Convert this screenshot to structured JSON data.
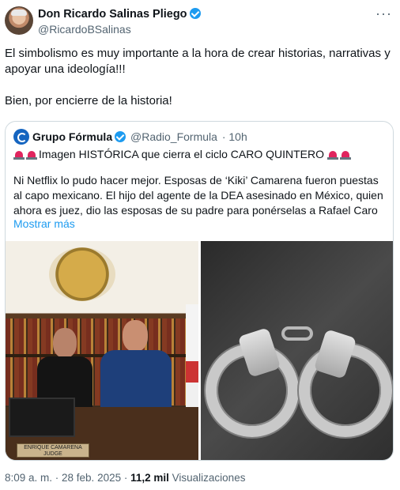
{
  "author": {
    "name": "Don Ricardo Salinas Pliego",
    "handle": "@RicardoBSalinas",
    "avatar_icon": "user-avatar",
    "verified_icon": "verified-badge-icon"
  },
  "menu_icon": "more-options-icon",
  "tweet": {
    "paragraph1": "El simbolismo es muy importante a la hora de crear historias, narrativas y apoyar una ideología!!!",
    "paragraph2": "Bien, por encierre de la historia!"
  },
  "quote": {
    "name": "Grupo Fórmula",
    "handle": "@Radio_Formula",
    "time": "· 10h",
    "headline": "Imagen HISTÓRICA que cierra el ciclo CARO QUINTERO",
    "body": "Ni Netflix lo pudo hacer mejor. Esposas de ‘Kiki’ Camarena fueron puestas al capo mexicano. El hijo del agente de la DEA asesinado en México, quien ahora es juez, dio las esposas de su padre para ponérselas a Rafael Caro",
    "more_label": "Mostrar más",
    "plate_line1": "ENRIQUE CAMARENA",
    "plate_line2": "JUDGE"
  },
  "footer": {
    "time": "8:09 a. m. · 28 feb. 2025 · ",
    "views_count": "11,2 mil",
    "views_label": " Visualizaciones"
  },
  "colors": {
    "accent": "#1d9bf0",
    "muted": "#536471",
    "border": "#cfd9de"
  }
}
